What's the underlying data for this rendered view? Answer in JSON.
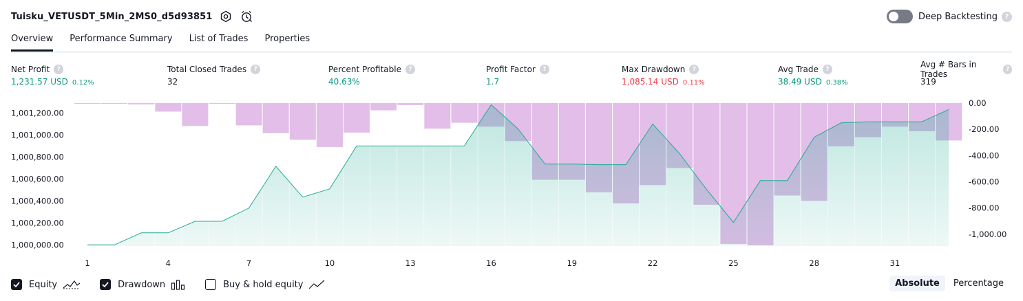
{
  "header": {
    "title": "Tuisku_VETUSDT_5Min_2MS0_d5d93851",
    "deep_backtesting_label": "Deep Backtesting"
  },
  "tabs": [
    {
      "label": "Overview",
      "active": true
    },
    {
      "label": "Performance Summary",
      "active": false
    },
    {
      "label": "List of Trades",
      "active": false
    },
    {
      "label": "Properties",
      "active": false
    }
  ],
  "metrics": [
    {
      "label": "Net Profit",
      "value": "1,231.57 USD",
      "pct": "0.12%",
      "color": "green"
    },
    {
      "label": "Total Closed Trades",
      "value": "32",
      "pct": "",
      "color": "black"
    },
    {
      "label": "Percent Profitable",
      "value": "40.63%",
      "pct": "",
      "color": "green"
    },
    {
      "label": "Profit Factor",
      "value": "1.7",
      "pct": "",
      "color": "green"
    },
    {
      "label": "Max Drawdown",
      "value": "1,085.14 USD",
      "pct": "0.11%",
      "color": "red"
    },
    {
      "label": "Avg Trade",
      "value": "38.49 USD",
      "pct": "0.38%",
      "color": "green"
    },
    {
      "label": "Avg # Bars in Trades",
      "value": "319",
      "pct": "",
      "color": "black"
    }
  ],
  "chart_data": {
    "type": "line",
    "x_tick_labels": [
      "1",
      "4",
      "7",
      "10",
      "13",
      "16",
      "19",
      "22",
      "25",
      "28",
      "31"
    ],
    "left_axis": {
      "tick_labels": [
        "1,001,200.00",
        "1,001,000.00",
        "1,000,800.00",
        "1,000,600.00",
        "1,000,400.00",
        "1,000,200.00",
        "1,000,000.00"
      ],
      "tick_values": [
        1001200,
        1001000,
        1000800,
        1000600,
        1000400,
        1000200,
        1000000
      ],
      "range": [
        999990,
        1001290
      ]
    },
    "right_axis": {
      "tick_labels": [
        "0.00",
        "-200.00",
        "-400.00",
        "-600.00",
        "-800.00",
        "-1,000.00"
      ],
      "tick_values": [
        0,
        -200,
        -400,
        -600,
        -800,
        -1000
      ],
      "range": [
        -1090,
        0
      ]
    },
    "series": [
      {
        "name": "Equity",
        "color": "#22ab94",
        "x": [
          1,
          2,
          3,
          4,
          5,
          6,
          7,
          8,
          9,
          10,
          11,
          12,
          13,
          14,
          15,
          16,
          17,
          18,
          19,
          20,
          21,
          22,
          23,
          24,
          25,
          26,
          27,
          28,
          29,
          30,
          31,
          32,
          33
        ],
        "values": [
          1000000,
          1000000,
          1000110,
          1000110,
          1000215,
          1000215,
          1000335,
          1000715,
          1000435,
          1000510,
          1000900,
          1000900,
          1000900,
          1000900,
          1000900,
          1001275,
          1001055,
          1000735,
          1000735,
          1000730,
          1000730,
          1001100,
          1000830,
          1000505,
          1000205,
          1000585,
          1000585,
          1000980,
          1001110,
          1001120,
          1001120,
          1001120,
          1001232
        ]
      },
      {
        "name": "Drawdown",
        "color": "#ce93d8",
        "x": [
          1,
          2,
          3,
          4,
          5,
          6,
          7,
          8,
          9,
          10,
          11,
          12,
          13,
          14,
          15,
          16,
          17,
          18,
          19,
          20,
          21,
          22,
          23,
          24,
          25,
          26,
          27,
          28,
          29,
          30,
          31,
          32,
          33
        ],
        "values": [
          -5,
          -5,
          -10,
          -65,
          -175,
          -5,
          -170,
          -230,
          -280,
          -335,
          -225,
          -55,
          -15,
          -195,
          -150,
          -180,
          -290,
          -585,
          -585,
          -680,
          -765,
          -625,
          -495,
          -775,
          -1075,
          -1085,
          -705,
          -745,
          -330,
          -260,
          -180,
          -215,
          -285
        ]
      }
    ]
  },
  "legend": [
    {
      "label": "Equity",
      "checked": true
    },
    {
      "label": "Drawdown",
      "checked": true
    },
    {
      "label": "Buy & hold equity",
      "checked": false
    }
  ],
  "modes": [
    {
      "label": "Absolute",
      "active": true
    },
    {
      "label": "Percentage",
      "active": false
    }
  ]
}
